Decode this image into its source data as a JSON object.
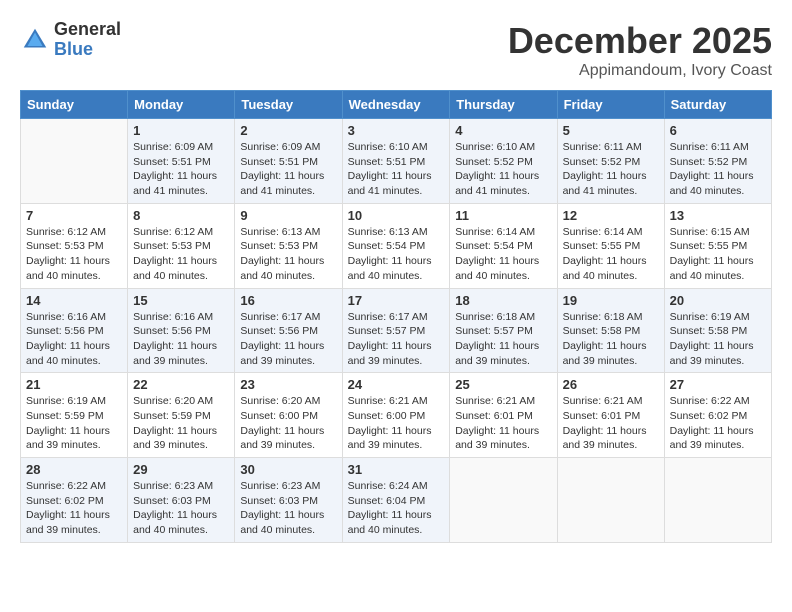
{
  "logo": {
    "general": "General",
    "blue": "Blue"
  },
  "title": "December 2025",
  "location": "Appimandoum, Ivory Coast",
  "days_header": [
    "Sunday",
    "Monday",
    "Tuesday",
    "Wednesday",
    "Thursday",
    "Friday",
    "Saturday"
  ],
  "weeks": [
    [
      {
        "day": "",
        "info": ""
      },
      {
        "day": "1",
        "sunrise": "Sunrise: 6:09 AM",
        "sunset": "Sunset: 5:51 PM",
        "daylight": "Daylight: 11 hours and 41 minutes."
      },
      {
        "day": "2",
        "sunrise": "Sunrise: 6:09 AM",
        "sunset": "Sunset: 5:51 PM",
        "daylight": "Daylight: 11 hours and 41 minutes."
      },
      {
        "day": "3",
        "sunrise": "Sunrise: 6:10 AM",
        "sunset": "Sunset: 5:51 PM",
        "daylight": "Daylight: 11 hours and 41 minutes."
      },
      {
        "day": "4",
        "sunrise": "Sunrise: 6:10 AM",
        "sunset": "Sunset: 5:52 PM",
        "daylight": "Daylight: 11 hours and 41 minutes."
      },
      {
        "day": "5",
        "sunrise": "Sunrise: 6:11 AM",
        "sunset": "Sunset: 5:52 PM",
        "daylight": "Daylight: 11 hours and 41 minutes."
      },
      {
        "day": "6",
        "sunrise": "Sunrise: 6:11 AM",
        "sunset": "Sunset: 5:52 PM",
        "daylight": "Daylight: 11 hours and 40 minutes."
      }
    ],
    [
      {
        "day": "7",
        "sunrise": "Sunrise: 6:12 AM",
        "sunset": "Sunset: 5:53 PM",
        "daylight": "Daylight: 11 hours and 40 minutes."
      },
      {
        "day": "8",
        "sunrise": "Sunrise: 6:12 AM",
        "sunset": "Sunset: 5:53 PM",
        "daylight": "Daylight: 11 hours and 40 minutes."
      },
      {
        "day": "9",
        "sunrise": "Sunrise: 6:13 AM",
        "sunset": "Sunset: 5:53 PM",
        "daylight": "Daylight: 11 hours and 40 minutes."
      },
      {
        "day": "10",
        "sunrise": "Sunrise: 6:13 AM",
        "sunset": "Sunset: 5:54 PM",
        "daylight": "Daylight: 11 hours and 40 minutes."
      },
      {
        "day": "11",
        "sunrise": "Sunrise: 6:14 AM",
        "sunset": "Sunset: 5:54 PM",
        "daylight": "Daylight: 11 hours and 40 minutes."
      },
      {
        "day": "12",
        "sunrise": "Sunrise: 6:14 AM",
        "sunset": "Sunset: 5:55 PM",
        "daylight": "Daylight: 11 hours and 40 minutes."
      },
      {
        "day": "13",
        "sunrise": "Sunrise: 6:15 AM",
        "sunset": "Sunset: 5:55 PM",
        "daylight": "Daylight: 11 hours and 40 minutes."
      }
    ],
    [
      {
        "day": "14",
        "sunrise": "Sunrise: 6:16 AM",
        "sunset": "Sunset: 5:56 PM",
        "daylight": "Daylight: 11 hours and 40 minutes."
      },
      {
        "day": "15",
        "sunrise": "Sunrise: 6:16 AM",
        "sunset": "Sunset: 5:56 PM",
        "daylight": "Daylight: 11 hours and 39 minutes."
      },
      {
        "day": "16",
        "sunrise": "Sunrise: 6:17 AM",
        "sunset": "Sunset: 5:56 PM",
        "daylight": "Daylight: 11 hours and 39 minutes."
      },
      {
        "day": "17",
        "sunrise": "Sunrise: 6:17 AM",
        "sunset": "Sunset: 5:57 PM",
        "daylight": "Daylight: 11 hours and 39 minutes."
      },
      {
        "day": "18",
        "sunrise": "Sunrise: 6:18 AM",
        "sunset": "Sunset: 5:57 PM",
        "daylight": "Daylight: 11 hours and 39 minutes."
      },
      {
        "day": "19",
        "sunrise": "Sunrise: 6:18 AM",
        "sunset": "Sunset: 5:58 PM",
        "daylight": "Daylight: 11 hours and 39 minutes."
      },
      {
        "day": "20",
        "sunrise": "Sunrise: 6:19 AM",
        "sunset": "Sunset: 5:58 PM",
        "daylight": "Daylight: 11 hours and 39 minutes."
      }
    ],
    [
      {
        "day": "21",
        "sunrise": "Sunrise: 6:19 AM",
        "sunset": "Sunset: 5:59 PM",
        "daylight": "Daylight: 11 hours and 39 minutes."
      },
      {
        "day": "22",
        "sunrise": "Sunrise: 6:20 AM",
        "sunset": "Sunset: 5:59 PM",
        "daylight": "Daylight: 11 hours and 39 minutes."
      },
      {
        "day": "23",
        "sunrise": "Sunrise: 6:20 AM",
        "sunset": "Sunset: 6:00 PM",
        "daylight": "Daylight: 11 hours and 39 minutes."
      },
      {
        "day": "24",
        "sunrise": "Sunrise: 6:21 AM",
        "sunset": "Sunset: 6:00 PM",
        "daylight": "Daylight: 11 hours and 39 minutes."
      },
      {
        "day": "25",
        "sunrise": "Sunrise: 6:21 AM",
        "sunset": "Sunset: 6:01 PM",
        "daylight": "Daylight: 11 hours and 39 minutes."
      },
      {
        "day": "26",
        "sunrise": "Sunrise: 6:21 AM",
        "sunset": "Sunset: 6:01 PM",
        "daylight": "Daylight: 11 hours and 39 minutes."
      },
      {
        "day": "27",
        "sunrise": "Sunrise: 6:22 AM",
        "sunset": "Sunset: 6:02 PM",
        "daylight": "Daylight: 11 hours and 39 minutes."
      }
    ],
    [
      {
        "day": "28",
        "sunrise": "Sunrise: 6:22 AM",
        "sunset": "Sunset: 6:02 PM",
        "daylight": "Daylight: 11 hours and 39 minutes."
      },
      {
        "day": "29",
        "sunrise": "Sunrise: 6:23 AM",
        "sunset": "Sunset: 6:03 PM",
        "daylight": "Daylight: 11 hours and 40 minutes."
      },
      {
        "day": "30",
        "sunrise": "Sunrise: 6:23 AM",
        "sunset": "Sunset: 6:03 PM",
        "daylight": "Daylight: 11 hours and 40 minutes."
      },
      {
        "day": "31",
        "sunrise": "Sunrise: 6:24 AM",
        "sunset": "Sunset: 6:04 PM",
        "daylight": "Daylight: 11 hours and 40 minutes."
      },
      {
        "day": "",
        "info": ""
      },
      {
        "day": "",
        "info": ""
      },
      {
        "day": "",
        "info": ""
      }
    ]
  ]
}
